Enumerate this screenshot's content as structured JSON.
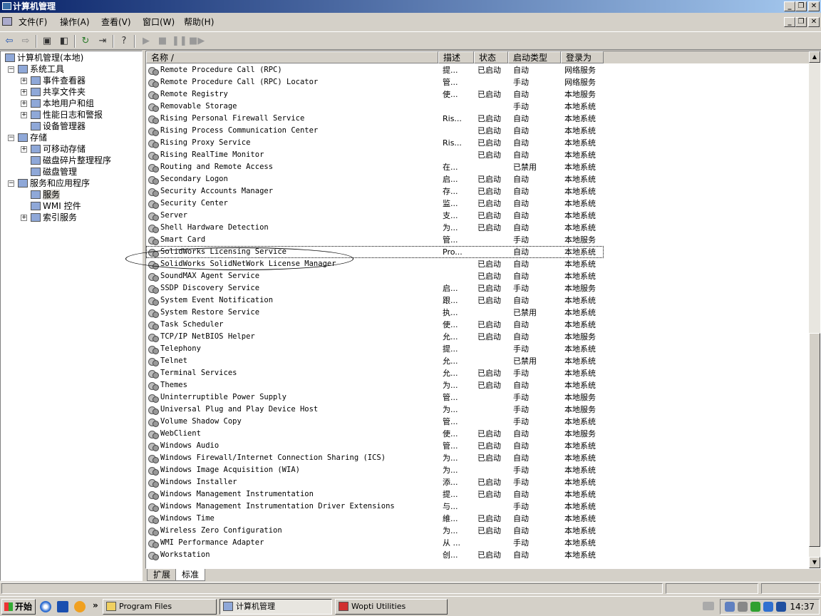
{
  "window": {
    "title": "计算机管理"
  },
  "menu": [
    "文件(F)",
    "操作(A)",
    "查看(V)",
    "窗口(W)",
    "帮助(H)"
  ],
  "tree": [
    {
      "label": "计算机管理(本地)",
      "indent": 0,
      "icon": "computer-icon",
      "expander": ""
    },
    {
      "label": "系统工具",
      "indent": 1,
      "icon": "tools-icon",
      "expander": "-"
    },
    {
      "label": "事件查看器",
      "indent": 2,
      "icon": "event-viewer-icon",
      "expander": "+"
    },
    {
      "label": "共享文件夹",
      "indent": 2,
      "icon": "shared-folder-icon",
      "expander": "+"
    },
    {
      "label": "本地用户和组",
      "indent": 2,
      "icon": "users-icon",
      "expander": "+"
    },
    {
      "label": "性能日志和警报",
      "indent": 2,
      "icon": "perf-log-icon",
      "expander": "+"
    },
    {
      "label": "设备管理器",
      "indent": 2,
      "icon": "device-manager-icon",
      "expander": ""
    },
    {
      "label": "存储",
      "indent": 1,
      "icon": "storage-icon",
      "expander": "-"
    },
    {
      "label": "可移动存储",
      "indent": 2,
      "icon": "removable-storage-icon",
      "expander": "+"
    },
    {
      "label": "磁盘碎片整理程序",
      "indent": 2,
      "icon": "defrag-icon",
      "expander": ""
    },
    {
      "label": "磁盘管理",
      "indent": 2,
      "icon": "disk-management-icon",
      "expander": ""
    },
    {
      "label": "服务和应用程序",
      "indent": 1,
      "icon": "services-apps-icon",
      "expander": "-"
    },
    {
      "label": "服务",
      "indent": 2,
      "icon": "services-icon",
      "expander": "",
      "selected": true
    },
    {
      "label": "WMI 控件",
      "indent": 2,
      "icon": "wmi-icon",
      "expander": ""
    },
    {
      "label": "索引服务",
      "indent": 2,
      "icon": "indexing-icon",
      "expander": "+"
    }
  ],
  "columns": {
    "name": "名称 /",
    "desc": "描述",
    "status": "状态",
    "start": "启动类型",
    "logon": "登录为"
  },
  "services": [
    [
      "Remote Procedure Call (RPC)",
      "提...",
      "已启动",
      "自动",
      "网络服务"
    ],
    [
      "Remote Procedure Call (RPC) Locator",
      "管...",
      "",
      "手动",
      "网络服务"
    ],
    [
      "Remote Registry",
      "使...",
      "已启动",
      "自动",
      "本地服务"
    ],
    [
      "Removable Storage",
      "",
      "",
      "手动",
      "本地系统"
    ],
    [
      "Rising Personal Firewall Service",
      "Ris...",
      "已启动",
      "自动",
      "本地系统"
    ],
    [
      "Rising Process Communication Center",
      "",
      "已启动",
      "自动",
      "本地系统"
    ],
    [
      "Rising Proxy  Service",
      "Ris...",
      "已启动",
      "自动",
      "本地系统"
    ],
    [
      "Rising RealTime Monitor",
      "",
      "已启动",
      "自动",
      "本地系统"
    ],
    [
      "Routing and Remote Access",
      "在...",
      "",
      "已禁用",
      "本地系统"
    ],
    [
      "Secondary Logon",
      "启...",
      "已启动",
      "自动",
      "本地系统"
    ],
    [
      "Security Accounts Manager",
      "存...",
      "已启动",
      "自动",
      "本地系统"
    ],
    [
      "Security Center",
      "监...",
      "已启动",
      "自动",
      "本地系统"
    ],
    [
      "Server",
      "支...",
      "已启动",
      "自动",
      "本地系统"
    ],
    [
      "Shell Hardware Detection",
      "为...",
      "已启动",
      "自动",
      "本地系统"
    ],
    [
      "Smart Card",
      "管...",
      "",
      "手动",
      "本地服务"
    ],
    [
      "SolidWorks Licensing Service",
      "Pro...",
      "",
      "自动",
      "本地系统"
    ],
    [
      "SolidWorks SolidNetWork License Manager",
      "",
      "已启动",
      "自动",
      "本地系统"
    ],
    [
      "SoundMAX Agent Service",
      "",
      "已启动",
      "自动",
      "本地系统"
    ],
    [
      "SSDP Discovery Service",
      "启...",
      "已启动",
      "手动",
      "本地服务"
    ],
    [
      "System Event Notification",
      "跟...",
      "已启动",
      "自动",
      "本地系统"
    ],
    [
      "System Restore Service",
      "执...",
      "",
      "已禁用",
      "本地系统"
    ],
    [
      "Task Scheduler",
      "使...",
      "已启动",
      "自动",
      "本地系统"
    ],
    [
      "TCP/IP NetBIOS Helper",
      "允...",
      "已启动",
      "自动",
      "本地服务"
    ],
    [
      "Telephony",
      "提...",
      "",
      "手动",
      "本地系统"
    ],
    [
      "Telnet",
      "允...",
      "",
      "已禁用",
      "本地系统"
    ],
    [
      "Terminal Services",
      "允...",
      "已启动",
      "手动",
      "本地系统"
    ],
    [
      "Themes",
      "为...",
      "已启动",
      "自动",
      "本地系统"
    ],
    [
      "Uninterruptible Power Supply",
      "管...",
      "",
      "手动",
      "本地服务"
    ],
    [
      "Universal Plug and Play Device Host",
      "为...",
      "",
      "手动",
      "本地服务"
    ],
    [
      "Volume Shadow Copy",
      "管...",
      "",
      "手动",
      "本地系统"
    ],
    [
      "WebClient",
      "使...",
      "已启动",
      "自动",
      "本地服务"
    ],
    [
      "Windows Audio",
      "管...",
      "已启动",
      "自动",
      "本地系统"
    ],
    [
      "Windows Firewall/Internet Connection Sharing (ICS)",
      "为...",
      "已启动",
      "自动",
      "本地系统"
    ],
    [
      "Windows Image Acquisition (WIA)",
      "为...",
      "",
      "手动",
      "本地系统"
    ],
    [
      "Windows Installer",
      "添...",
      "已启动",
      "手动",
      "本地系统"
    ],
    [
      "Windows Management Instrumentation",
      "提...",
      "已启动",
      "自动",
      "本地系统"
    ],
    [
      "Windows Management Instrumentation Driver Extensions",
      "与...",
      "",
      "手动",
      "本地系统"
    ],
    [
      "Windows Time",
      "維...",
      "已启动",
      "自动",
      "本地系统"
    ],
    [
      "Wireless Zero Configuration",
      "为...",
      "已启动",
      "自动",
      "本地系统"
    ],
    [
      "WMI Performance Adapter",
      "从 ...",
      "",
      "手动",
      "本地系统"
    ],
    [
      "Workstation",
      "创...",
      "已启动",
      "自动",
      "本地系统"
    ]
  ],
  "focused_service_index": 15,
  "tabs": [
    "扩展",
    "标准"
  ],
  "active_tab_index": 1,
  "taskbar": {
    "start": "开始",
    "overflow": "»",
    "tasks": [
      "Program Files",
      "计算机管理",
      "Wopti Utilities"
    ],
    "active_task_index": 1,
    "clock": "14:37"
  },
  "colors": {
    "title_start": "#0a246a",
    "title_end": "#a6caf0",
    "face": "#d4d0c8"
  }
}
